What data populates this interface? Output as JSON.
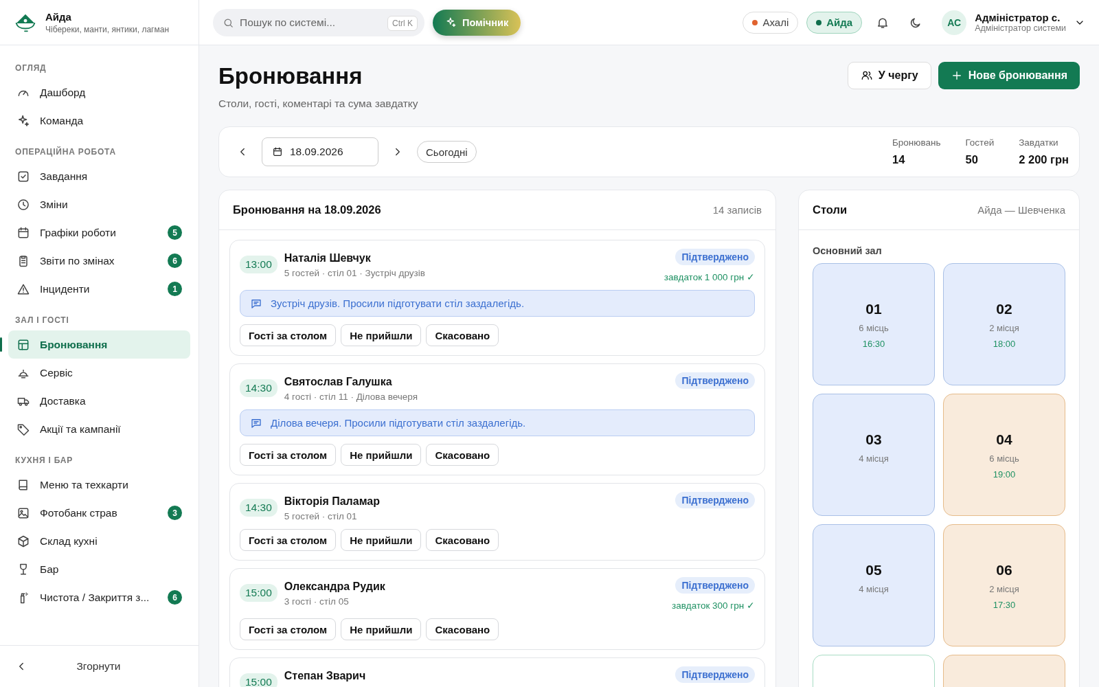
{
  "brand": {
    "name": "Айда",
    "tagline": "Чібереки, манти, янтики, лагман"
  },
  "search": {
    "placeholder": "Пошук по системі...",
    "shortcut": "Ctrl K"
  },
  "assistant_button": "Помічник",
  "locations": [
    {
      "label": "Ахалі",
      "selected": false,
      "color": "#e0622e"
    },
    {
      "label": "Айда",
      "selected": true,
      "color": "#0f6e4c"
    }
  ],
  "user": {
    "initials": "АС",
    "name": "Адміністратор с.",
    "role": "Адміністратор системи"
  },
  "sidebar": {
    "sections": [
      {
        "title": "ОГЛЯД",
        "items": [
          {
            "label": "Дашборд",
            "selected": false
          },
          {
            "label": "Команда",
            "selected": false
          }
        ]
      },
      {
        "title": "ОПЕРАЦІЙНА РОБОТА",
        "items": [
          {
            "label": "Завдання",
            "selected": false
          },
          {
            "label": "Зміни",
            "selected": false
          },
          {
            "label": "Графіки роботи",
            "selected": false,
            "badge": "5"
          },
          {
            "label": "Звіти по змінах",
            "selected": false,
            "badge": "6"
          },
          {
            "label": "Інциденти",
            "selected": false,
            "badge": "1"
          }
        ]
      },
      {
        "title": "ЗАЛ І ГОСТІ",
        "items": [
          {
            "label": "Бронювання",
            "selected": true
          },
          {
            "label": "Сервіс",
            "selected": false
          },
          {
            "label": "Доставка",
            "selected": false
          },
          {
            "label": "Акції та кампанії",
            "selected": false
          }
        ]
      },
      {
        "title": "КУХНЯ І БАР",
        "items": [
          {
            "label": "Меню та техкарти",
            "selected": false
          },
          {
            "label": "Фотобанк страв",
            "selected": false,
            "badge": "3"
          },
          {
            "label": "Склад кухні",
            "selected": false
          },
          {
            "label": "Бар",
            "selected": false
          },
          {
            "label": "Чистота / Закриття з...",
            "selected": false,
            "badge": "6"
          }
        ]
      }
    ],
    "collapse": "Згорнути"
  },
  "page": {
    "title": "Бронювання",
    "subtitle": "Столи, гості, коментарі та сума завдатку",
    "queue_button": "У чергу",
    "new_button": "Нове бронювання"
  },
  "date_bar": {
    "date": "18.09.2026",
    "today": "Сьогодні",
    "stats": [
      {
        "label": "Бронювань",
        "value": "14"
      },
      {
        "label": "Гостей",
        "value": "50"
      },
      {
        "label": "Завдатки",
        "value": "2 200 грн"
      }
    ]
  },
  "reservations": {
    "title": "Бронювання на 18.09.2026",
    "count": "14 записів",
    "items": [
      {
        "time": "13:00",
        "name": "Наталія Шевчук",
        "details": "5 гостей · стіл 01 · Зустріч друзів",
        "status": "Підтверджено",
        "deposit": "завдаток 1 000 грн ✓",
        "note": "Зустріч друзів. Просили підготувати стіл заздалегідь.",
        "actions": [
          "Гості за столом",
          "Не прийшли",
          "Скасовано"
        ]
      },
      {
        "time": "14:30",
        "name": "Святослав Галушка",
        "details": "4 гості · стіл 11 · Ділова вечеря",
        "status": "Підтверджено",
        "note": "Ділова вечеря. Просили підготувати стіл заздалегідь.",
        "actions": [
          "Гості за столом",
          "Не прийшли",
          "Скасовано"
        ]
      },
      {
        "time": "14:30",
        "name": "Вікторія Паламар",
        "details": "5 гостей · стіл 01",
        "status": "Підтверджено",
        "actions": [
          "Гості за столом",
          "Не прийшли",
          "Скасовано"
        ]
      },
      {
        "time": "15:00",
        "name": "Олександра Рудик",
        "details": "3 гості · стіл 05",
        "status": "Підтверджено",
        "deposit": "завдаток 300 грн ✓",
        "actions": [
          "Гості за столом",
          "Не прийшли",
          "Скасовано"
        ]
      },
      {
        "time": "15:00",
        "name": "Степан Зварич",
        "status": "Підтверджено"
      }
    ]
  },
  "tables": {
    "title": "Столи",
    "location": "Айда — Шевченка",
    "hall": "Основний зал",
    "items": [
      {
        "number": "01",
        "seats": "6 місць",
        "time": "16:30",
        "kind": "reserved"
      },
      {
        "number": "02",
        "seats": "2 місця",
        "time": "18:00",
        "kind": "reserved"
      },
      {
        "number": "03",
        "seats": "4 місця",
        "kind": "reserved"
      },
      {
        "number": "04",
        "seats": "6 місць",
        "time": "19:00",
        "kind": "occupied"
      },
      {
        "number": "05",
        "seats": "4 місця",
        "kind": "reserved"
      },
      {
        "number": "06",
        "seats": "2 місця",
        "time": "17:30",
        "kind": "occupied"
      },
      {
        "kind": "free"
      },
      {
        "kind": "occupied"
      }
    ]
  }
}
